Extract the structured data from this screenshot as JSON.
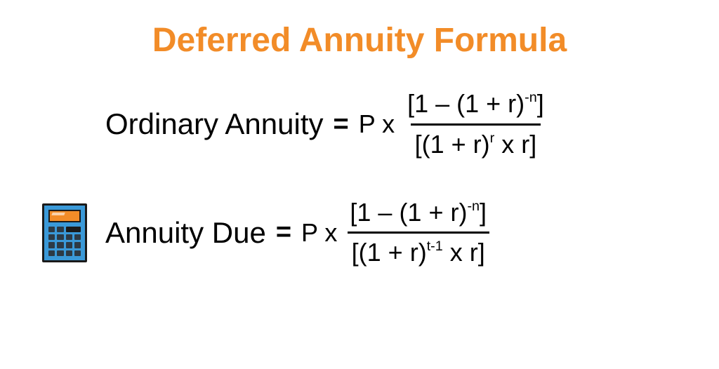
{
  "title": "Deferred Annuity Formula",
  "formulas": {
    "ordinary": {
      "label": "Ordinary Annuity",
      "equals": "=",
      "pterm": "P x",
      "numerator_pre": "[1 – (1 + r)",
      "numerator_sup": "-n",
      "numerator_post": "]",
      "denominator_pre": "[(1 + r)",
      "denominator_sup": "r",
      "denominator_post": " x r]"
    },
    "due": {
      "label": "Annuity Due",
      "equals": "=",
      "pterm": "P x",
      "numerator_pre": "[1 – (1 + r)",
      "numerator_sup": "-n",
      "numerator_post": "]",
      "denominator_pre": "[(1 + r)",
      "denominator_sup": "t-1",
      "denominator_post": " x r]"
    }
  }
}
